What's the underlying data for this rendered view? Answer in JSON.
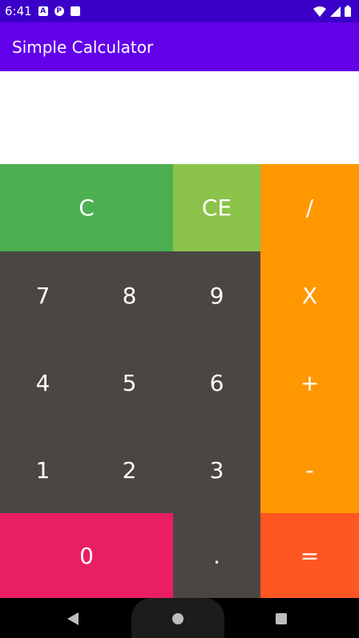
{
  "status_bar": {
    "time": "6:41",
    "left_icons": [
      "notification-a-icon",
      "notification-p-icon",
      "sd-card-icon"
    ],
    "right_icons": [
      "wifi-icon",
      "signal-icon",
      "battery-icon"
    ]
  },
  "app_bar": {
    "title": "Simple Calculator"
  },
  "display": {
    "value": ""
  },
  "keys": {
    "clear": "C",
    "clear_entry": "CE",
    "divide": "/",
    "seven": "7",
    "eight": "8",
    "nine": "9",
    "multiply": "X",
    "four": "4",
    "five": "5",
    "six": "6",
    "plus": "+",
    "one": "1",
    "two": "2",
    "three": "3",
    "minus": "-",
    "zero": "0",
    "dot": ".",
    "equals": "="
  },
  "colors": {
    "status_bar": "#3b00c8",
    "app_bar": "#6200ea",
    "clear_key": "#4caf50",
    "clear_entry_key": "#8bc34a",
    "operator_key": "#ff9800",
    "digit_key": "#4a4743",
    "zero_key": "#e91e63",
    "equals_key": "#ff5722"
  },
  "nav_bar": {
    "icons": [
      "back-icon",
      "home-icon",
      "recents-icon"
    ]
  }
}
